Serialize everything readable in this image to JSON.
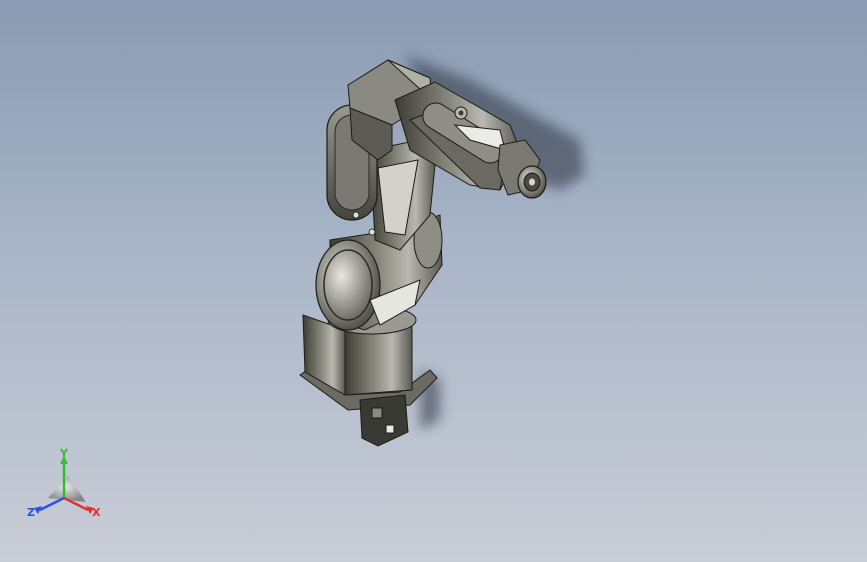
{
  "viewport": {
    "background_top": "#8a9bb3",
    "background_bottom": "#c9cdd7"
  },
  "model": {
    "body_color": "#4a4a40",
    "highlight_color": "#d8d8d0"
  },
  "triad": {
    "x_label": "X",
    "y_label": "Y",
    "z_label": "Z",
    "x_color": "#e23030",
    "y_color": "#2fbf2f",
    "z_color": "#2f4fe0"
  }
}
